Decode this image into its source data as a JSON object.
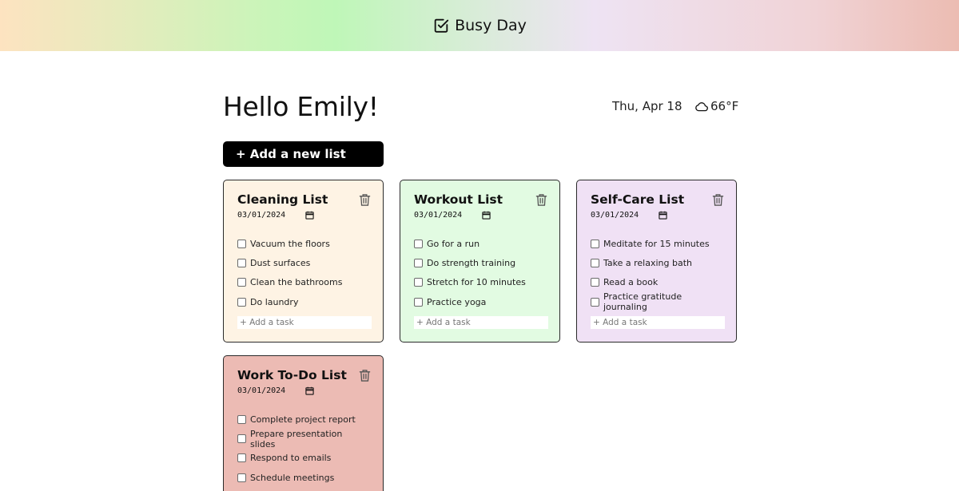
{
  "app": {
    "title": "Busy Day"
  },
  "header": {
    "greeting": "Hello Emily!",
    "date": "Thu, Apr 18",
    "temperature": "66°F",
    "weather_icon": "cloud-icon"
  },
  "actions": {
    "add_list_label": "+ Add a new list"
  },
  "lists": [
    {
      "title": "Cleaning List",
      "date": "03/01/2024",
      "color": "#fef3e4",
      "tasks": [
        "Vacuum the floors",
        "Dust surfaces",
        "Clean the bathrooms",
        "Do laundry"
      ],
      "add_task_placeholder": "+ Add a task"
    },
    {
      "title": "Workout List",
      "date": "03/01/2024",
      "color": "#e2fbe2",
      "tasks": [
        "Go for a run",
        "Do strength training",
        "Stretch for 10 minutes",
        "Practice yoga"
      ],
      "add_task_placeholder": "+ Add a task"
    },
    {
      "title": "Self-Care List",
      "date": "03/01/2024",
      "color": "#f0e1f5",
      "tasks": [
        "Meditate for 15 minutes",
        "Take a relaxing bath",
        "Read a book",
        "Practice gratitude journaling"
      ],
      "add_task_placeholder": "+ Add a task"
    },
    {
      "title": "Work To-Do List",
      "date": "03/01/2024",
      "color": "#ecbbb4",
      "tasks": [
        "Complete project report",
        "Prepare presentation slides",
        "Respond to emails",
        "Schedule meetings"
      ]
    }
  ]
}
